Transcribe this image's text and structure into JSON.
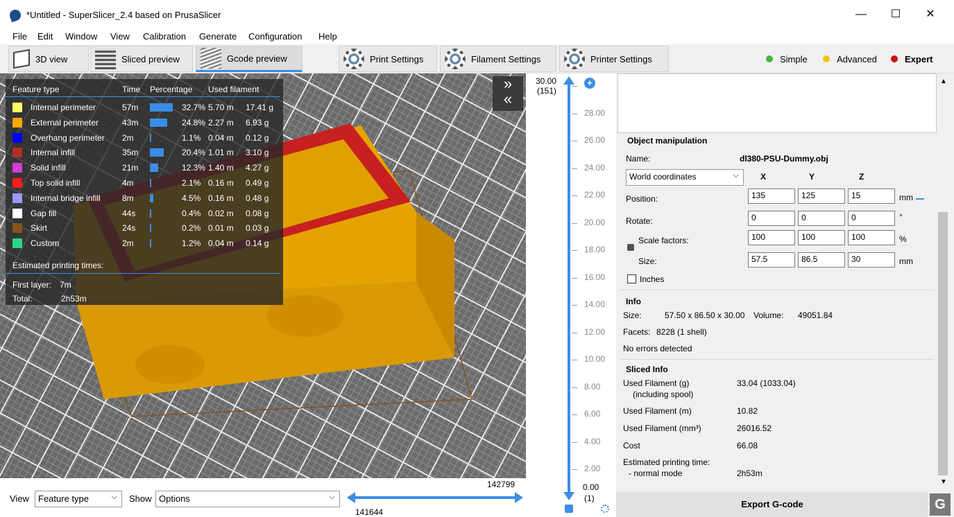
{
  "window": {
    "title": "*Untitled - SuperSlicer_2.4  based on PrusaSlicer",
    "minimize": "—",
    "maximize": "☐",
    "close": "✕"
  },
  "menu": [
    "File",
    "Edit",
    "Window",
    "View",
    "Calibration",
    "Generate",
    "Configuration",
    "Help"
  ],
  "tabs": {
    "view3d": "3D view",
    "sliced": "Sliced preview",
    "gcode": "Gcode preview",
    "print": "Print Settings",
    "filament": "Filament Settings",
    "printer": "Printer Settings"
  },
  "modes": {
    "simple": "Simple",
    "advanced": "Advanced",
    "expert": "Expert",
    "colors": {
      "simple": "#3fb83f",
      "advanced": "#f2c30a",
      "expert": "#d01010"
    }
  },
  "legend": {
    "headers": {
      "feature": "Feature type",
      "time": "Time",
      "pct": "Percentage",
      "used": "Used filament"
    },
    "rows": [
      {
        "name": "Internal perimeter",
        "time": "57m",
        "pct": "32.7%",
        "len": "5.70 m",
        "g": "17.41 g",
        "color": "#ffff66",
        "frac": 0.327
      },
      {
        "name": "External perimeter",
        "time": "43m",
        "pct": "24.8%",
        "len": "2.27 m",
        "g": "6.93 g",
        "color": "#ffa500",
        "frac": 0.248
      },
      {
        "name": "Overhang perimeter",
        "time": "2m",
        "pct": "1.1%",
        "len": "0.04 m",
        "g": "0.12 g",
        "color": "#0000ff",
        "frac": 0.011
      },
      {
        "name": "Internal infill",
        "time": "35m",
        "pct": "20.4%",
        "len": "1.01 m",
        "g": "3.10 g",
        "color": "#b03029",
        "frac": 0.204
      },
      {
        "name": "Solid infill",
        "time": "21m",
        "pct": "12.3%",
        "len": "1.40 m",
        "g": "4.27 g",
        "color": "#d23cd2",
        "frac": 0.123
      },
      {
        "name": "Top solid infill",
        "time": "4m",
        "pct": "2.1%",
        "len": "0.16 m",
        "g": "0.49 g",
        "color": "#ff1a1a",
        "frac": 0.021
      },
      {
        "name": "Internal bridge infill",
        "time": "8m",
        "pct": "4.5%",
        "len": "0.16 m",
        "g": "0.48 g",
        "color": "#9999ff",
        "frac": 0.045
      },
      {
        "name": "Gap fill",
        "time": "44s",
        "pct": "0.4%",
        "len": "0.02 m",
        "g": "0.08 g",
        "color": "#ffffff",
        "frac": 0.004
      },
      {
        "name": "Skirt",
        "time": "24s",
        "pct": "0.2%",
        "len": "0.01 m",
        "g": "0.03 g",
        "color": "#845321",
        "frac": 0.002
      },
      {
        "name": "Custom",
        "time": "2m",
        "pct": "1.2%",
        "len": "0.04 m",
        "g": "0.14 g",
        "color": "#2bd68c",
        "frac": 0.012
      }
    ],
    "est_title": "Estimated printing times:",
    "first_layer_label": "First layer:",
    "first_layer": "7m",
    "total_label": "Total:",
    "total": "2h53m"
  },
  "bottom": {
    "view_label": "View",
    "view_value": "Feature type",
    "show_label": "Show",
    "show_value": "Options",
    "h_max": "142799",
    "h_min": "141644"
  },
  "vslider": {
    "top_value": "30.00",
    "top_layer": "(151)",
    "bottom_value": "0.00",
    "bottom_layer": "(1)",
    "ticks": [
      "30.00",
      "28.00",
      "26.00",
      "24.00",
      "22.00",
      "20.00",
      "18.00",
      "16.00",
      "14.00",
      "12.00",
      "10.00",
      "8.00",
      "6.00",
      "4.00",
      "2.00"
    ]
  },
  "object": {
    "section": "Object manipulation",
    "name_label": "Name:",
    "name": "dl380-PSU-Dummy.obj",
    "coords": "World coordinates",
    "x": "X",
    "y": "Y",
    "z": "Z",
    "position_label": "Position:",
    "position": [
      "135",
      "125",
      "15"
    ],
    "pos_unit": "mm",
    "rotate_label": "Rotate:",
    "rotate": [
      "0",
      "0",
      "0"
    ],
    "rot_unit": "°",
    "scale_label": "Scale factors:",
    "scale": [
      "100",
      "100",
      "100"
    ],
    "scale_unit": "%",
    "size_label": "Size:",
    "size": [
      "57.5",
      "86.5",
      "30"
    ],
    "size_unit": "mm",
    "inches": "Inches"
  },
  "info": {
    "section": "Info",
    "size_label": "Size:",
    "size": "57.50 x 86.50 x 30.00",
    "volume_label": "Volume:",
    "volume": "49051.84",
    "facets_label": "Facets:",
    "facets": "8228 (1 shell)",
    "errors": "No errors detected"
  },
  "sliced": {
    "section": "Sliced Info",
    "rows": [
      {
        "label": "Used Filament (g)",
        "sub": "(including spool)",
        "value": "33.04 (1033.04)"
      },
      {
        "label": "Used Filament (m)",
        "sub": "",
        "value": "10.82"
      },
      {
        "label": "Used Filament (mm³)",
        "sub": "",
        "value": "26016.52"
      },
      {
        "label": "Cost",
        "sub": "",
        "value": "66.08"
      },
      {
        "label": "Estimated printing time:",
        "sub": "- normal mode",
        "value": "2h53m"
      }
    ]
  },
  "export": "Export G-code"
}
